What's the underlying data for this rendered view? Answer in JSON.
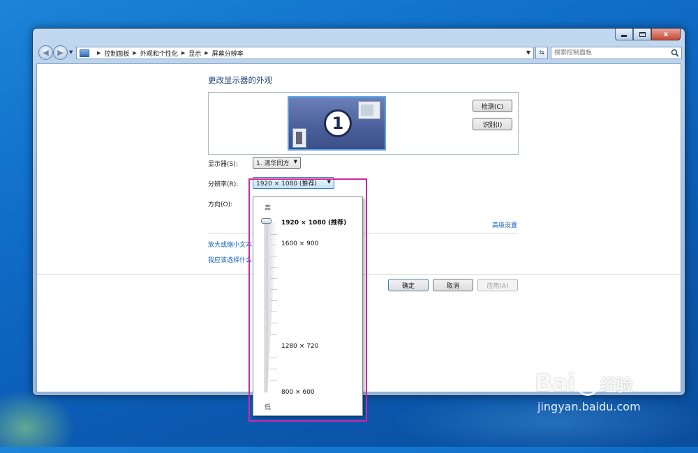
{
  "window": {
    "minimize_icon": "minimize-icon",
    "maximize_icon": "maximize-icon",
    "close_label": "x"
  },
  "address_bar": {
    "crumbs": [
      "控制面板",
      "外观和个性化",
      "显示",
      "屏幕分辨率"
    ],
    "search_placeholder": "搜索控制面板"
  },
  "main": {
    "title": "更改显示器的外观",
    "monitor_number": "1",
    "detect_button": "检测(C)",
    "identify_button": "识别(I)",
    "display_label": "显示器(S):",
    "display_value": "1. 清华同方",
    "resolution_label": "分辨率(R):",
    "resolution_value": "1920 × 1080 (推荐)",
    "orientation_label": "方向(O):",
    "advanced_link": "高级设置",
    "link_text_size": "放大或缩小文本",
    "link_which_settings": "我应该选择什么",
    "ok_button": "确定",
    "cancel_button": "取消",
    "apply_button": "应用(A)"
  },
  "resolution_popup": {
    "high_label": "高",
    "low_label": "低",
    "options": [
      "1920 × 1080 (推荐)",
      "1600 × 900",
      "1280 × 720",
      "800 × 600"
    ],
    "selected_index": 0
  },
  "watermark": {
    "logo": "Bai",
    "logo_tail": "经验",
    "url": "jingyan.baidu.com"
  },
  "colors": {
    "link": "#0b5fb8",
    "title": "#1d3f77",
    "highlight_box": "#d026a8"
  }
}
